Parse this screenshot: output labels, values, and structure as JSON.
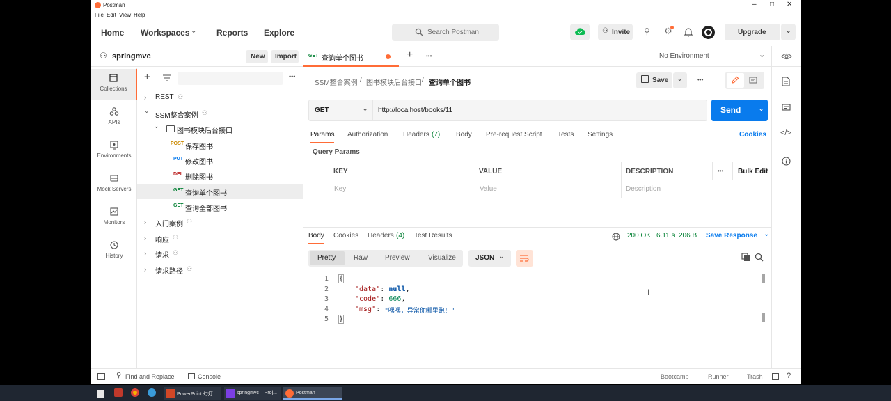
{
  "window": {
    "title": "Postman",
    "menu": [
      "File",
      "Edit",
      "View",
      "Help"
    ],
    "controls": [
      "–",
      "□",
      "✕"
    ]
  },
  "header": {
    "nav": [
      "Home",
      "Workspaces",
      "Reports",
      "Explore"
    ],
    "search_label": "Search Postman",
    "invite_label": "Invite",
    "upgrade_label": "Upgrade"
  },
  "workspace": {
    "name": "springmvc",
    "new_label": "New",
    "import_label": "Import"
  },
  "rail": {
    "items": [
      "Collections",
      "APIs",
      "Environments",
      "Mock Servers",
      "Monitors",
      "History"
    ],
    "active": "Collections"
  },
  "tree": {
    "rows": [
      {
        "label": "REST",
        "chev": "›",
        "shared": true
      },
      {
        "label": "SSM整合案例",
        "chev": "⌄",
        "shared": true
      },
      {
        "label": "图书模块后台接口",
        "chev": "⌄",
        "folder": true
      },
      {
        "label": "保存图书",
        "method": "POST",
        "color": "#ca8a04"
      },
      {
        "label": "修改图书",
        "method": "PUT",
        "color": "#097bed"
      },
      {
        "label": "删除图书",
        "method": "DEL",
        "color": "#b91c1c"
      },
      {
        "label": "查询单个图书",
        "method": "GET",
        "color": "#007f31",
        "selected": true
      },
      {
        "label": "查询全部图书",
        "method": "GET",
        "color": "#007f31"
      },
      {
        "label": "入门案例",
        "chev": "›",
        "shared": true
      },
      {
        "label": "响应",
        "chev": "›",
        "shared": true
      },
      {
        "label": "请求",
        "chev": "›",
        "shared": true
      },
      {
        "label": "请求路径",
        "chev": "›",
        "shared": true
      }
    ]
  },
  "tab": {
    "method": "GET",
    "name": "查询单个图书",
    "environment": "No Environment"
  },
  "breadcrumb": {
    "parts": [
      "SSM整合案例",
      "图书模块后台接口",
      "查询单个图书"
    ],
    "separator": "/",
    "save_label": "Save"
  },
  "request": {
    "method": "GET",
    "url": "http://localhost/books/11",
    "send_label": "Send",
    "tabs": [
      "Params",
      "Authorization",
      "Headers",
      "Body",
      "Pre-request Script",
      "Tests",
      "Settings"
    ],
    "headers_count": "(7)",
    "cookies_label": "Cookies"
  },
  "params": {
    "title": "Query Params",
    "columns": [
      "KEY",
      "VALUE",
      "DESCRIPTION"
    ],
    "more": "•••",
    "bulk_edit": "Bulk Edit",
    "placeholders": [
      "Key",
      "Value",
      "Description"
    ]
  },
  "response": {
    "tabs": [
      "Body",
      "Cookies",
      "Headers",
      "Test Results"
    ],
    "headers_count": "(4)",
    "status": "200 OK",
    "time": "6.11 s",
    "size": "206 B",
    "save_label": "Save Response",
    "views": [
      "Pretty",
      "Raw",
      "Preview",
      "Visualize"
    ],
    "format": "JSON",
    "lines": [
      {
        "n": "1",
        "text": "{"
      },
      {
        "n": "2",
        "key": "\"data\"",
        "val": "null",
        "type": "kw"
      },
      {
        "n": "3",
        "key": "\"code\"",
        "val": "666",
        "type": "num"
      },
      {
        "n": "4",
        "key": "\"msg\"",
        "val": "\"嘿嘿，异常你哪里跑！\"",
        "type": "str"
      },
      {
        "n": "5",
        "text": "}"
      }
    ]
  },
  "statusbar": {
    "find_replace": "Find and Replace",
    "console": "Console",
    "bootcamp": "Bootcamp",
    "runner": "Runner",
    "trash": "Trash"
  },
  "taskbar": {
    "apps": [
      "PowerPoint 幻灯...",
      "springmvc – Proj...",
      "Postman"
    ]
  },
  "colors": {
    "accent": "#ff6c37",
    "send": "#097bed",
    "get": "#007f31",
    "status_ok": "#007f31"
  }
}
